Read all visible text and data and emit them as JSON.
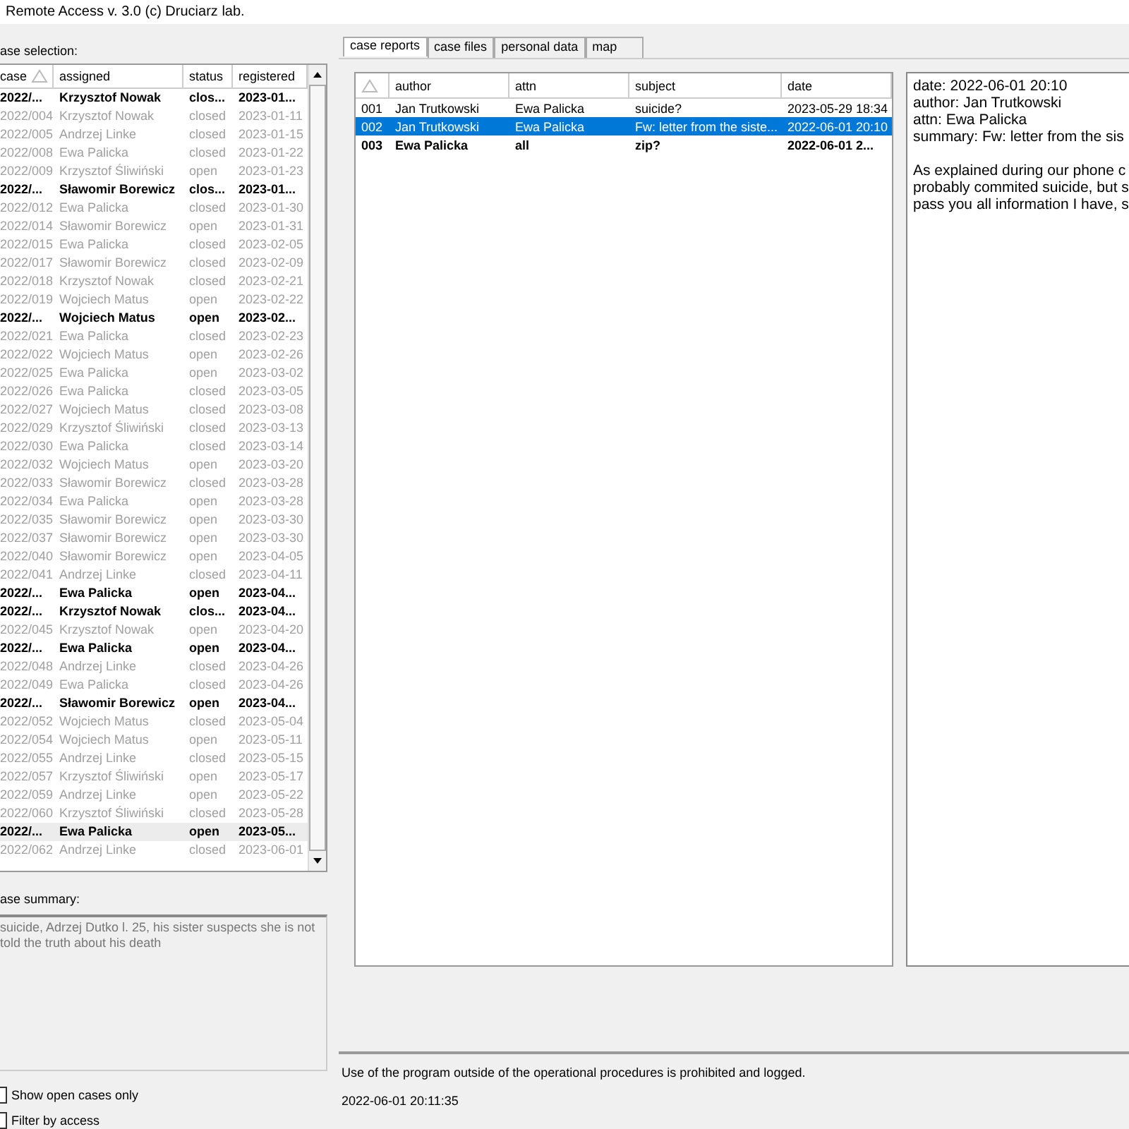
{
  "window": {
    "title": "Remote Access v. 3.0 (c) Druciarz lab."
  },
  "case_selection": {
    "label": "ase selection:",
    "columns": [
      {
        "label": "case",
        "sorted": true
      },
      {
        "label": "assigned",
        "sorted": false
      },
      {
        "label": "status",
        "sorted": false
      },
      {
        "label": "registered",
        "sorted": false
      }
    ],
    "rows": [
      {
        "case": "2022/...",
        "assigned": "Krzysztof Nowak",
        "status": "clos...",
        "registered": "2023-01...",
        "bold": true,
        "selected": false
      },
      {
        "case": "2022/004",
        "assigned": "Krzysztof Nowak",
        "status": "closed",
        "registered": "2023-01-11",
        "bold": false,
        "selected": false
      },
      {
        "case": "2022/005",
        "assigned": "Andrzej Linke",
        "status": "closed",
        "registered": "2023-01-15",
        "bold": false,
        "selected": false
      },
      {
        "case": "2022/008",
        "assigned": "Ewa Palicka",
        "status": "closed",
        "registered": "2023-01-22",
        "bold": false,
        "selected": false
      },
      {
        "case": "2022/009",
        "assigned": "Krzysztof Śliwiński",
        "status": "open",
        "registered": "2023-01-23",
        "bold": false,
        "selected": false
      },
      {
        "case": "2022/...",
        "assigned": "Sławomir Borewicz",
        "status": "clos...",
        "registered": "2023-01...",
        "bold": true,
        "selected": false
      },
      {
        "case": "2022/012",
        "assigned": "Ewa Palicka",
        "status": "closed",
        "registered": "2023-01-30",
        "bold": false,
        "selected": false
      },
      {
        "case": "2022/014",
        "assigned": "Sławomir Borewicz",
        "status": "open",
        "registered": "2023-01-31",
        "bold": false,
        "selected": false
      },
      {
        "case": "2022/015",
        "assigned": "Ewa Palicka",
        "status": "closed",
        "registered": "2023-02-05",
        "bold": false,
        "selected": false
      },
      {
        "case": "2022/017",
        "assigned": "Sławomir Borewicz",
        "status": "closed",
        "registered": "2023-02-09",
        "bold": false,
        "selected": false
      },
      {
        "case": "2022/018",
        "assigned": "Krzysztof Nowak",
        "status": "closed",
        "registered": "2023-02-21",
        "bold": false,
        "selected": false
      },
      {
        "case": "2022/019",
        "assigned": "Wojciech Matus",
        "status": "open",
        "registered": "2023-02-22",
        "bold": false,
        "selected": false
      },
      {
        "case": "2022/...",
        "assigned": "Wojciech Matus",
        "status": "open",
        "registered": "2023-02...",
        "bold": true,
        "selected": false
      },
      {
        "case": "2022/021",
        "assigned": "Ewa Palicka",
        "status": "closed",
        "registered": "2023-02-23",
        "bold": false,
        "selected": false
      },
      {
        "case": "2022/022",
        "assigned": "Wojciech Matus",
        "status": "open",
        "registered": "2023-02-26",
        "bold": false,
        "selected": false
      },
      {
        "case": "2022/025",
        "assigned": "Ewa Palicka",
        "status": "open",
        "registered": "2023-03-02",
        "bold": false,
        "selected": false
      },
      {
        "case": "2022/026",
        "assigned": "Ewa Palicka",
        "status": "closed",
        "registered": "2023-03-05",
        "bold": false,
        "selected": false
      },
      {
        "case": "2022/027",
        "assigned": "Wojciech Matus",
        "status": "closed",
        "registered": "2023-03-08",
        "bold": false,
        "selected": false
      },
      {
        "case": "2022/029",
        "assigned": "Krzysztof Śliwiński",
        "status": "closed",
        "registered": "2023-03-13",
        "bold": false,
        "selected": false
      },
      {
        "case": "2022/030",
        "assigned": "Ewa Palicka",
        "status": "closed",
        "registered": "2023-03-14",
        "bold": false,
        "selected": false
      },
      {
        "case": "2022/032",
        "assigned": "Wojciech Matus",
        "status": "open",
        "registered": "2023-03-20",
        "bold": false,
        "selected": false
      },
      {
        "case": "2022/033",
        "assigned": "Sławomir Borewicz",
        "status": "closed",
        "registered": "2023-03-28",
        "bold": false,
        "selected": false
      },
      {
        "case": "2022/034",
        "assigned": "Ewa Palicka",
        "status": "open",
        "registered": "2023-03-28",
        "bold": false,
        "selected": false
      },
      {
        "case": "2022/035",
        "assigned": "Sławomir Borewicz",
        "status": "open",
        "registered": "2023-03-30",
        "bold": false,
        "selected": false
      },
      {
        "case": "2022/037",
        "assigned": "Sławomir Borewicz",
        "status": "open",
        "registered": "2023-03-30",
        "bold": false,
        "selected": false
      },
      {
        "case": "2022/040",
        "assigned": "Sławomir Borewicz",
        "status": "open",
        "registered": "2023-04-05",
        "bold": false,
        "selected": false
      },
      {
        "case": "2022/041",
        "assigned": "Andrzej Linke",
        "status": "closed",
        "registered": "2023-04-11",
        "bold": false,
        "selected": false
      },
      {
        "case": "2022/...",
        "assigned": "Ewa Palicka",
        "status": "open",
        "registered": "2023-04...",
        "bold": true,
        "selected": false
      },
      {
        "case": "2022/...",
        "assigned": "Krzysztof Nowak",
        "status": "clos...",
        "registered": "2023-04...",
        "bold": true,
        "selected": false
      },
      {
        "case": "2022/045",
        "assigned": "Krzysztof Nowak",
        "status": "open",
        "registered": "2023-04-20",
        "bold": false,
        "selected": false
      },
      {
        "case": "2022/...",
        "assigned": "Ewa Palicka",
        "status": "open",
        "registered": "2023-04...",
        "bold": true,
        "selected": false
      },
      {
        "case": "2022/048",
        "assigned": "Andrzej Linke",
        "status": "closed",
        "registered": "2023-04-26",
        "bold": false,
        "selected": false
      },
      {
        "case": "2022/049",
        "assigned": "Ewa Palicka",
        "status": "closed",
        "registered": "2023-04-26",
        "bold": false,
        "selected": false
      },
      {
        "case": "2022/...",
        "assigned": "Sławomir Borewicz",
        "status": "open",
        "registered": "2023-04...",
        "bold": true,
        "selected": false
      },
      {
        "case": "2022/052",
        "assigned": "Wojciech Matus",
        "status": "closed",
        "registered": "2023-05-04",
        "bold": false,
        "selected": false
      },
      {
        "case": "2022/054",
        "assigned": "Wojciech Matus",
        "status": "open",
        "registered": "2023-05-11",
        "bold": false,
        "selected": false
      },
      {
        "case": "2022/055",
        "assigned": "Andrzej Linke",
        "status": "closed",
        "registered": "2023-05-15",
        "bold": false,
        "selected": false
      },
      {
        "case": "2022/057",
        "assigned": "Krzysztof Śliwiński",
        "status": "open",
        "registered": "2023-05-17",
        "bold": false,
        "selected": false
      },
      {
        "case": "2022/059",
        "assigned": "Andrzej Linke",
        "status": "open",
        "registered": "2023-05-22",
        "bold": false,
        "selected": false
      },
      {
        "case": "2022/060",
        "assigned": "Krzysztof Śliwiński",
        "status": "closed",
        "registered": "2023-05-28",
        "bold": false,
        "selected": false
      },
      {
        "case": "2022/...",
        "assigned": "Ewa Palicka",
        "status": "open",
        "registered": "2023-05...",
        "bold": true,
        "selected": true
      },
      {
        "case": "2022/062",
        "assigned": "Andrzej Linke",
        "status": "closed",
        "registered": "2023-06-01",
        "bold": false,
        "selected": false
      }
    ]
  },
  "case_summary": {
    "label": "ase summary:",
    "text": "suicide, Adrzej Dutko l. 25, his sister suspects she is not told the truth about his death"
  },
  "filters": [
    {
      "label": "Show open cases only",
      "checked": false
    },
    {
      "label": "Filter by access",
      "checked": false
    }
  ],
  "tabs": [
    {
      "label": "case reports",
      "selected": true
    },
    {
      "label": "case files",
      "selected": false
    },
    {
      "label": "personal data",
      "selected": false
    },
    {
      "label": "map",
      "selected": false
    }
  ],
  "reports": {
    "columns": [
      {
        "sorted": true
      },
      {
        "label": "author",
        "sorted": false
      },
      {
        "label": "attn",
        "sorted": false
      },
      {
        "label": "subject",
        "sorted": false
      },
      {
        "label": "date",
        "sorted": false
      }
    ],
    "rows": [
      {
        "number": "001",
        "author": "Jan Trutkowski",
        "attn": "Ewa Palicka",
        "subject": "suicide?",
        "date": "2023-05-29 18:34",
        "bold": false,
        "selected": false
      },
      {
        "number": "002",
        "author": "Jan Trutkowski",
        "attn": "Ewa Palicka",
        "subject": "Fw: letter from the siste...",
        "date": "2022-06-01 20:10",
        "bold": false,
        "selected": true
      },
      {
        "number": "003",
        "author": "Ewa Palicka",
        "attn": "all",
        "subject": "zip?",
        "date": "2022-06-01 2...",
        "bold": true,
        "selected": false
      }
    ]
  },
  "report_detail": {
    "header_lines": [
      "date: 2022-06-01 20:10",
      "author: Jan Trutkowski",
      "attn: Ewa Palicka",
      "summary: Fw: letter from the sis"
    ],
    "body_lines": [
      "As explained during our phone c",
      "probably commited suicide, but s",
      "pass you all information I have, s"
    ]
  },
  "notice": "Use of the program outside of the operational procedures is prohibited and logged.",
  "timestamp": "2022-06-01 20:11:35"
}
